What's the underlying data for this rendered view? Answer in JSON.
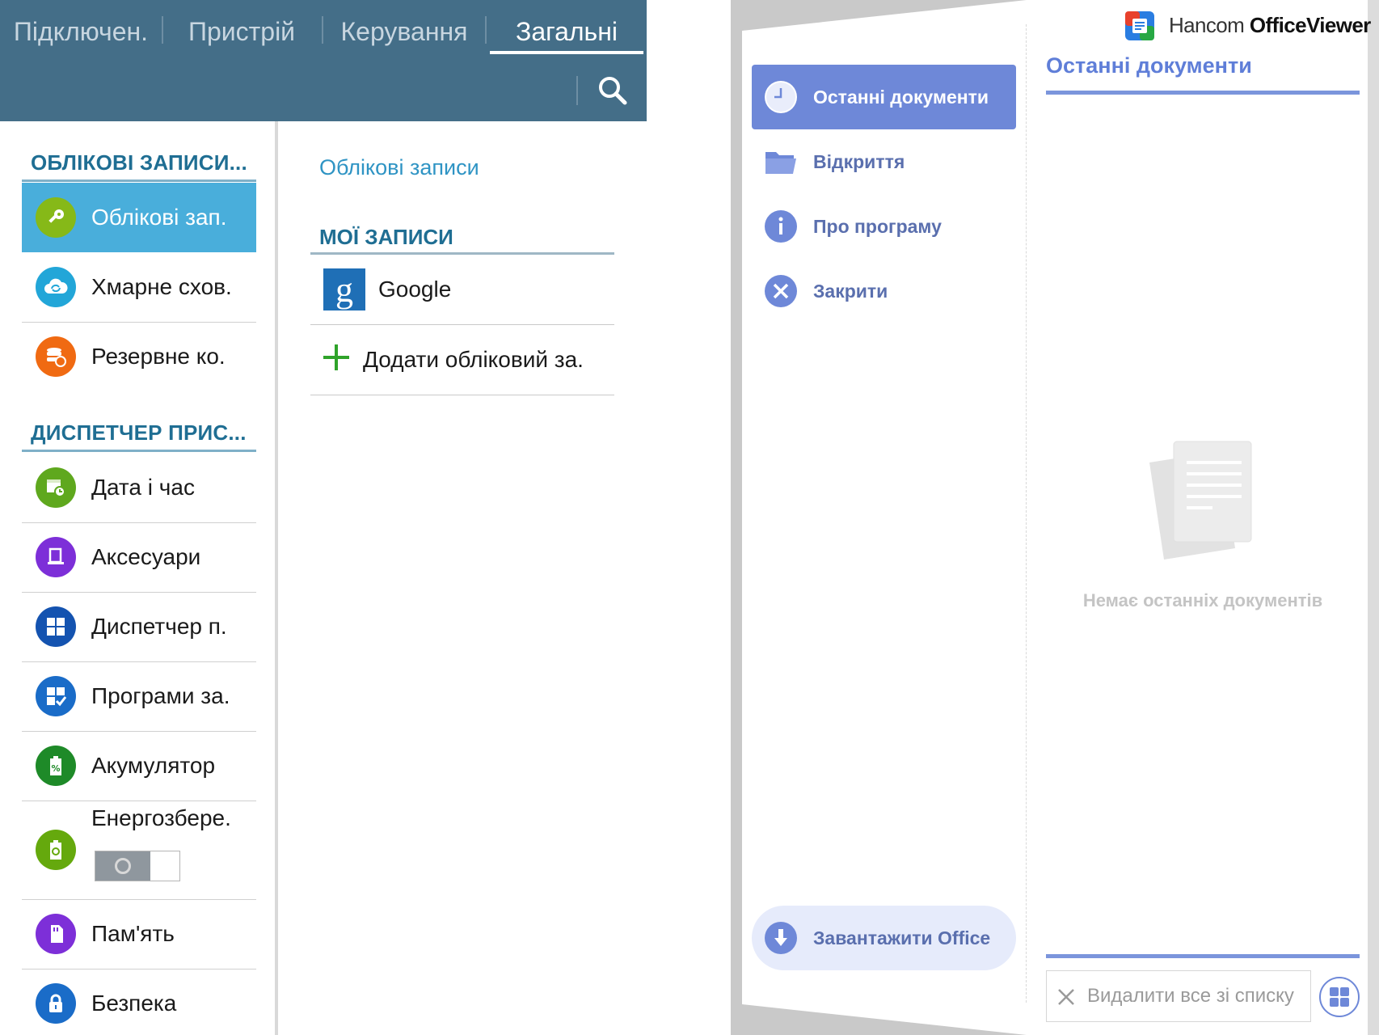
{
  "settings": {
    "tabs": [
      {
        "label": "Підключен."
      },
      {
        "label": "Пристрій"
      },
      {
        "label": "Керування"
      },
      {
        "label": "Загальні"
      }
    ],
    "active_tab": "Загальні",
    "section_accounts": "ОБЛІКОВІ ЗАПИСИ...",
    "section_device_manager": "ДИСПЕТЧЕР ПРИС...",
    "items": [
      {
        "label": "Облікові зап.",
        "icon": "key-icon",
        "color": "#86b918"
      },
      {
        "label": "Хмарне схов.",
        "icon": "cloud-sync-icon",
        "color": "#22a6d8"
      },
      {
        "label": "Резервне ко.",
        "icon": "backup-database-icon",
        "color": "#f06a12"
      },
      {
        "label": "Дата і час",
        "icon": "calendar-clock-icon",
        "color": "#5fa81e"
      },
      {
        "label": "Аксесуари",
        "icon": "accessory-icon",
        "color": "#7d2fd8"
      },
      {
        "label": "Диспетчер п.",
        "icon": "apps-grid-icon",
        "color": "#1453b0"
      },
      {
        "label": "Програми за.",
        "icon": "default-apps-icon",
        "color": "#1a6cc8"
      },
      {
        "label": "Акумулятор",
        "icon": "battery-icon",
        "color": "#1e8a28"
      },
      {
        "label": "Енергозбере.",
        "icon": "power-saving-icon",
        "color": "#65a90d"
      },
      {
        "label": "Пам'ять",
        "icon": "sd-card-icon",
        "color": "#7d2fd8"
      },
      {
        "label": "Безпека",
        "icon": "lock-icon",
        "color": "#1a6cc8"
      }
    ],
    "power_saving_enabled": false,
    "content": {
      "heading": "Облікові записи",
      "my_accounts_title": "МОЇ ЗАПИСИ",
      "accounts": [
        {
          "label": "Google",
          "icon": "google-icon"
        }
      ],
      "add_account_label": "Додати обліковий за."
    }
  },
  "viewer": {
    "app_name_light": "Hancom",
    "app_name_bold": "Office",
    "app_name_tail": "Viewer",
    "nav": [
      {
        "label": "Останні документи",
        "icon": "clock-icon",
        "active": true
      },
      {
        "label": "Відкриття",
        "icon": "folder-icon",
        "active": false
      },
      {
        "label": "Про програму",
        "icon": "info-icon",
        "active": false
      },
      {
        "label": "Закрити",
        "icon": "close-icon",
        "active": false
      }
    ],
    "download_label": "Завантажити Office",
    "recent_title": "Останні документи",
    "empty_text": "Немає останніх документів",
    "clear_label": "Видалити все зі списку",
    "accent": "#6e88d8"
  }
}
